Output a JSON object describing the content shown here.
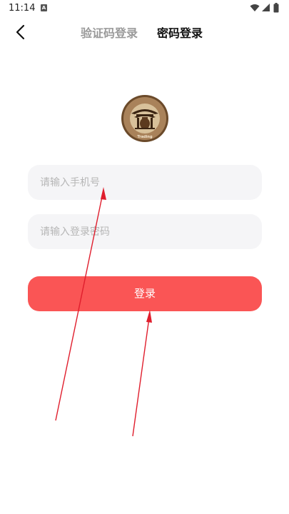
{
  "status_bar": {
    "time": "11:14",
    "notification_glyph": "A",
    "icons": [
      "wifi-icon",
      "signal-icon",
      "battery-icon"
    ]
  },
  "header": {
    "back_icon": "chevron-left-icon",
    "tabs": [
      {
        "label": "验证码登录",
        "active": false
      },
      {
        "label": "密码登录",
        "active": true
      }
    ]
  },
  "form": {
    "phone_placeholder": "请输入手机号",
    "phone_value": "",
    "password_placeholder": "请输入登录密码",
    "password_value": "",
    "login_label": "登录"
  },
  "colors": {
    "accent": "#fa5555",
    "input_bg": "#f5f5f7",
    "annotation": "#e01e2d"
  }
}
